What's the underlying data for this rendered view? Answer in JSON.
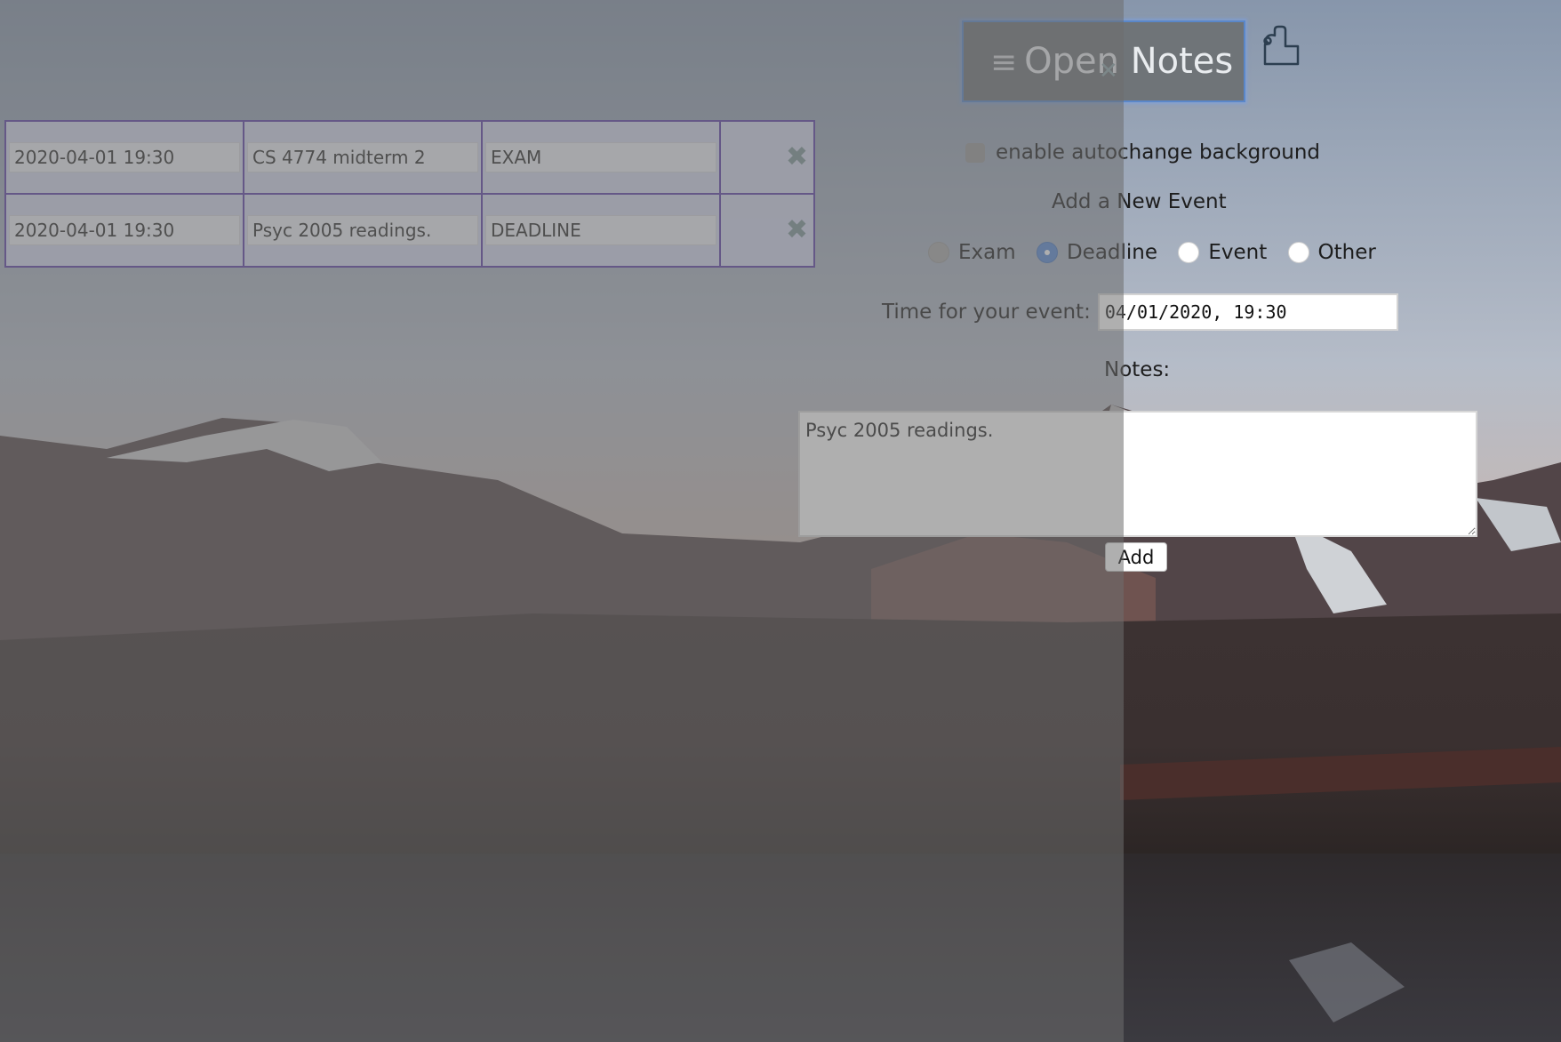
{
  "header": {
    "open_notes_label": "Open Notes",
    "menu_icon": "≡",
    "close_icon": "✕"
  },
  "events": [
    {
      "time": "2020-04-01 19:30",
      "name": "CS 4774 midterm 2",
      "type": "EXAM"
    },
    {
      "time": "2020-04-01 19:30",
      "name": "Psyc 2005 readings.",
      "type": "DEADLINE"
    }
  ],
  "delete_icon": "✖",
  "settings": {
    "autochange_label": "enable autochange background",
    "autochange_checked": false
  },
  "form": {
    "title": "Add a New Event",
    "radios": [
      {
        "label": "Exam",
        "checked": false
      },
      {
        "label": "Deadline",
        "checked": true
      },
      {
        "label": "Event",
        "checked": false
      },
      {
        "label": "Other",
        "checked": false
      }
    ],
    "time_label": "Time for your event:",
    "time_value": "04/01/2020, 19:30",
    "notes_label": "Notes:",
    "notes_value": "Psyc 2005 readings.",
    "add_label": "Add"
  },
  "colors": {
    "table_border": "#5b3fa6",
    "table_cell": "#d6daf2",
    "delete_icon": "#7d9598",
    "focus_ring": "#5a87c9",
    "radio_checked": "#5a8ad4"
  }
}
